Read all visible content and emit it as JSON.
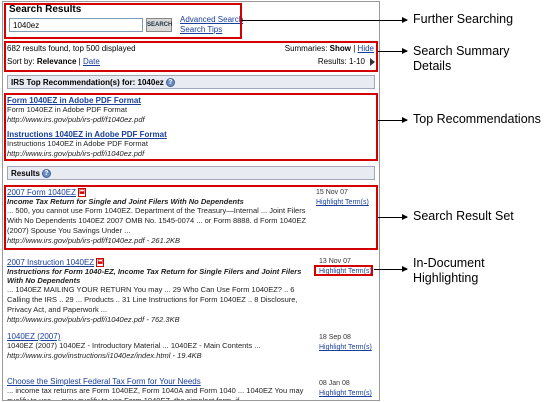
{
  "screen": {
    "title": "Search Results",
    "search_value": "1040ez",
    "search_button": "SEARCH",
    "advanced_search": "Advanced Search",
    "search_tips": "Search Tips",
    "summary_count": "682 results found, top 500 displayed",
    "summaries_label": "Summaries:",
    "summaries_show": "Show",
    "summaries_sep": "|",
    "summaries_hide": "Hide",
    "sort_label": "Sort by:",
    "sort_relevance": "Relevance",
    "sort_sep": "|",
    "sort_date": "Date",
    "results_range": "Results: 1-10",
    "top_rec_header": "IRS Top Recommendation(s) for: 1040ez",
    "top_recs": [
      {
        "title": "Form 1040EZ in Adobe PDF Format",
        "desc": "Form 1040EZ in Adobe PDF Format",
        "url": "http://www.irs.gov/pub/irs-pdf/f1040ez.pdf"
      },
      {
        "title": "Instructions 1040EZ in Adobe PDF Format",
        "desc": "Instructions 1040EZ in Adobe PDF Format",
        "url": "http://www.irs.gov/pub/irs-pdf/i1040ez.pdf"
      }
    ],
    "results_header": "Results",
    "pdf_icon": "pdf-icon",
    "results": [
      {
        "title": "2007 Form 1040EZ",
        "subtitle": "Income Tax Return for Single and Joint Filers With No Dependents",
        "snippet": "... 500, you cannot use Form 1040EZ. Department of the Treasury—Internal ... Joint Filers With No Dependents 1040EZ 2007 OMB No. 1545-0074 ... or Form 8888. d Form 1040EZ (2007) Spouse You Savings Under ...",
        "url": "http://www.irs.gov/pub/irs-pdf/f1040ez.pdf - 261.2KB",
        "date": "15 Nov 07",
        "highlight": "Highlight Term(s)"
      },
      {
        "title": "2007 Instruction 1040EZ",
        "subtitle": "Instructions for Form 1040-EZ, Income Tax Return for Single Filers and Joint Filers With No Dependents",
        "snippet": "... 1040EZ MAILING YOUR RETURN You may ... 29 Who Can Use Form 1040EZ? .. 6 Calling the IRS .. 29 ... Products .. 31 Line Instructions for Form 1040EZ .. 8 Disclosure, Privacy Act, and Paperwork ...",
        "url": "http://www.irs.gov/pub/irs-pdf/i1040ez.pdf - 762.3KB",
        "date": "13 Nov 07",
        "highlight": "Highlight Term(s)"
      },
      {
        "title": "1040EZ (2007)",
        "subtitle": "",
        "snippet": "1040EZ (2007) 1040EZ - Introductory Material ... 1040EZ - Main Contents ...",
        "url": "http://www.irs.gov/instructions/i1040ez/index.html - 19.4KB",
        "date": "18 Sep 08",
        "highlight": "Highlight Term(s)"
      },
      {
        "title": "Choose the Simplest Federal Tax Form for Your Needs",
        "subtitle": "",
        "snippet": "... income tax returns are Form 1040EZ, Form 1040A and Form 1040 ... 1040EZ You may qualify to use ... may qualify to use Form 1040EZ, the simplest form, if ...",
        "url": "",
        "date": "08 Jan 08",
        "highlight": "Highlight Term(s)"
      }
    ]
  },
  "callouts": [
    "Further Searching",
    "Search Summary Details",
    "Top Recommendations",
    "Search Result Set",
    "In-Document Highlighting"
  ],
  "colors": {
    "annotation": "#d40000",
    "link": "#1a3e9c"
  }
}
